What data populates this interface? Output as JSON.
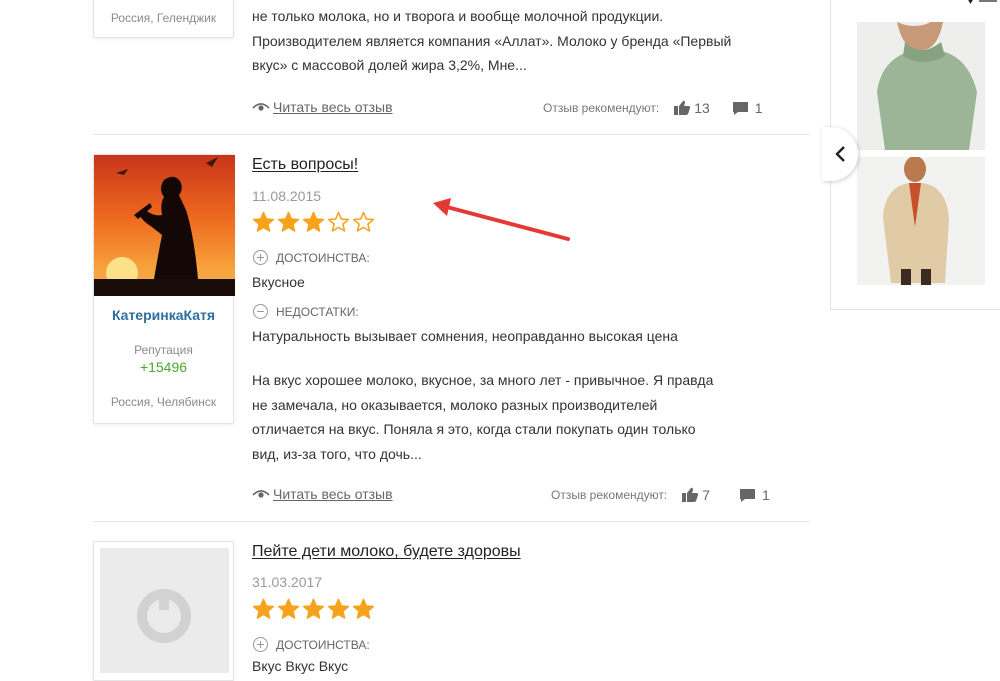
{
  "top_review": {
    "user_city": "Россия, Геленджик",
    "text_line_1": "не только молока, но и творога и вообще молочной продукции.",
    "text_line_2": "Производителем является компания «Аллат». Молоко у бренда «Первый",
    "text_line_3": "вкус» с массовой долей жира 3,2%, Мне...",
    "read_more": "Читать весь отзыв",
    "recommend_label": "Отзыв рекомендуют:",
    "likes": "13",
    "comments": "1"
  },
  "main_review": {
    "user_name": "КатеринкаКатя",
    "reputation_label": "Репутация",
    "reputation_value": "+15496",
    "user_city": "Россия, Челябинск",
    "title": "Есть вопросы!",
    "date": "11.08.2015",
    "rating": 3,
    "pros_label": "ДОСТОИНСТВА:",
    "pros": "Вкусное",
    "cons_label": "НЕДОСТАТКИ:",
    "cons": "Натуральность вызывает сомнения, неоправданно высокая цена",
    "text_line_1": "На вкус хорошее молоко, вкусное, за много лет - привычное. Я правда",
    "text_line_2": "не замечала, но оказывается, молоко разных производителей",
    "text_line_3": "отличается на вкус. Поняла я это, когда стали покупать один только",
    "text_line_4": "вид, из-за того, что дочь...",
    "read_more": "Читать весь отзыв",
    "recommend_label": "Отзыв рекомендуют:",
    "likes": "7",
    "comments": "1"
  },
  "third_review": {
    "title": "Пейте дети молоко, будете здоровы",
    "date": "31.03.2017",
    "rating": 5,
    "pros_label": "ДОСТОИНСТВА:",
    "pros": "Вкус Вкус Вкус"
  },
  "annotation": {
    "arrow_color": "#e53935"
  },
  "colors": {
    "star_fill": "#f7a21b",
    "username": "#2e6f9e",
    "reputation": "#4aa832"
  },
  "icons": {
    "read_more": "eye-icon",
    "likes": "thumbs-up-icon",
    "comments": "comment-icon",
    "carousel_prev": "chevron-left-icon"
  }
}
